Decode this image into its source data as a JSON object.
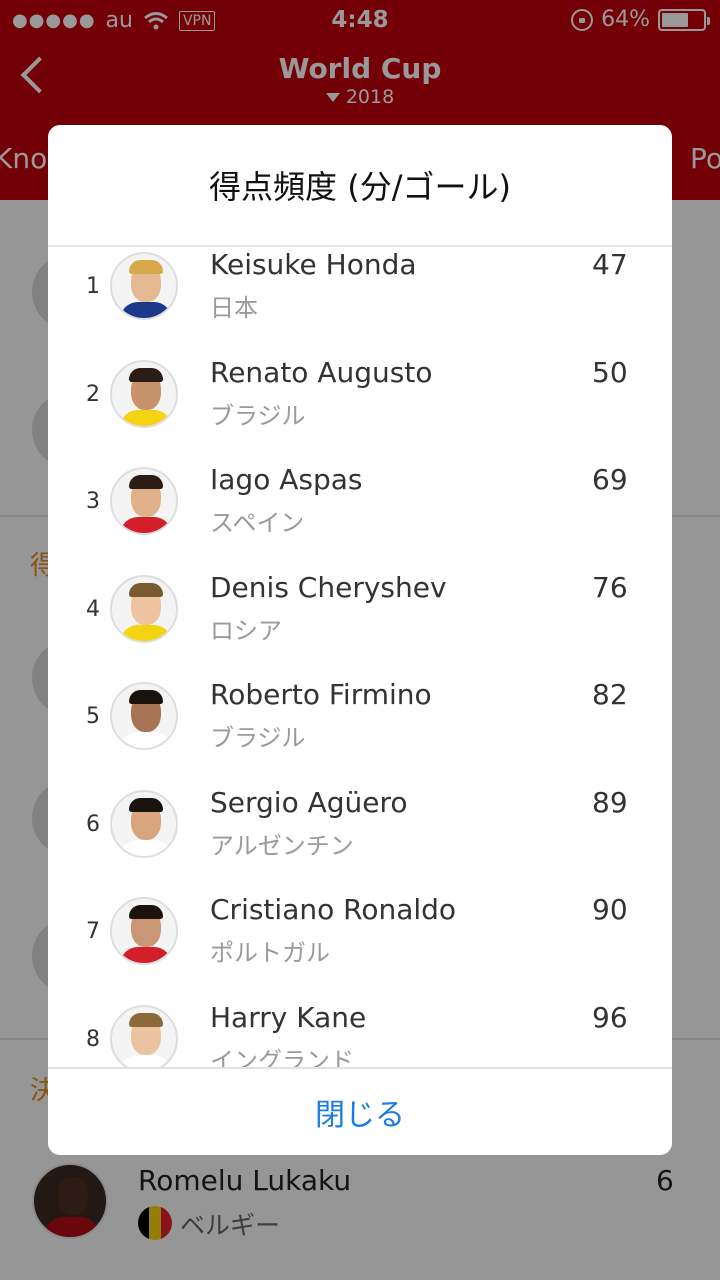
{
  "status_bar": {
    "dots": "●●●●●",
    "carrier": "au",
    "vpn": "VPN",
    "time": "4:48",
    "battery": "64%",
    "battery_level": 0.64
  },
  "header": {
    "title": "World Cup",
    "year": "2018",
    "tab_left": "Knoc",
    "tab_right": "Po"
  },
  "background": {
    "section_mark_1": "得",
    "section_mark_2": "決",
    "bottom_row": {
      "name": "Romelu Lukaku",
      "country": "ベルギー",
      "count": "6"
    }
  },
  "dialog": {
    "title": "得点頻度 (分/ゴール)",
    "close_label": "閉じる",
    "rows": [
      {
        "rank": "1",
        "name": "Keisuke Honda",
        "country": "日本",
        "value": "47"
      },
      {
        "rank": "2",
        "name": "Renato Augusto",
        "country": "ブラジル",
        "value": "50"
      },
      {
        "rank": "3",
        "name": "Iago Aspas",
        "country": "スペイン",
        "value": "69"
      },
      {
        "rank": "4",
        "name": "Denis Cheryshev",
        "country": "ロシア",
        "value": "76"
      },
      {
        "rank": "5",
        "name": "Roberto Firmino",
        "country": "ブラジル",
        "value": "82"
      },
      {
        "rank": "6",
        "name": "Sergio Agüero",
        "country": "アルゼンチン",
        "value": "89"
      },
      {
        "rank": "7",
        "name": "Cristiano Ronaldo",
        "country": "ポルトガル",
        "value": "90"
      },
      {
        "rank": "8",
        "name": "Harry Kane",
        "country": "イングランド",
        "value": "96"
      }
    ]
  },
  "colors": {
    "header_red": "#c0000a",
    "accent_blue": "#1a7ce6",
    "section_orange": "#e88a1a"
  }
}
